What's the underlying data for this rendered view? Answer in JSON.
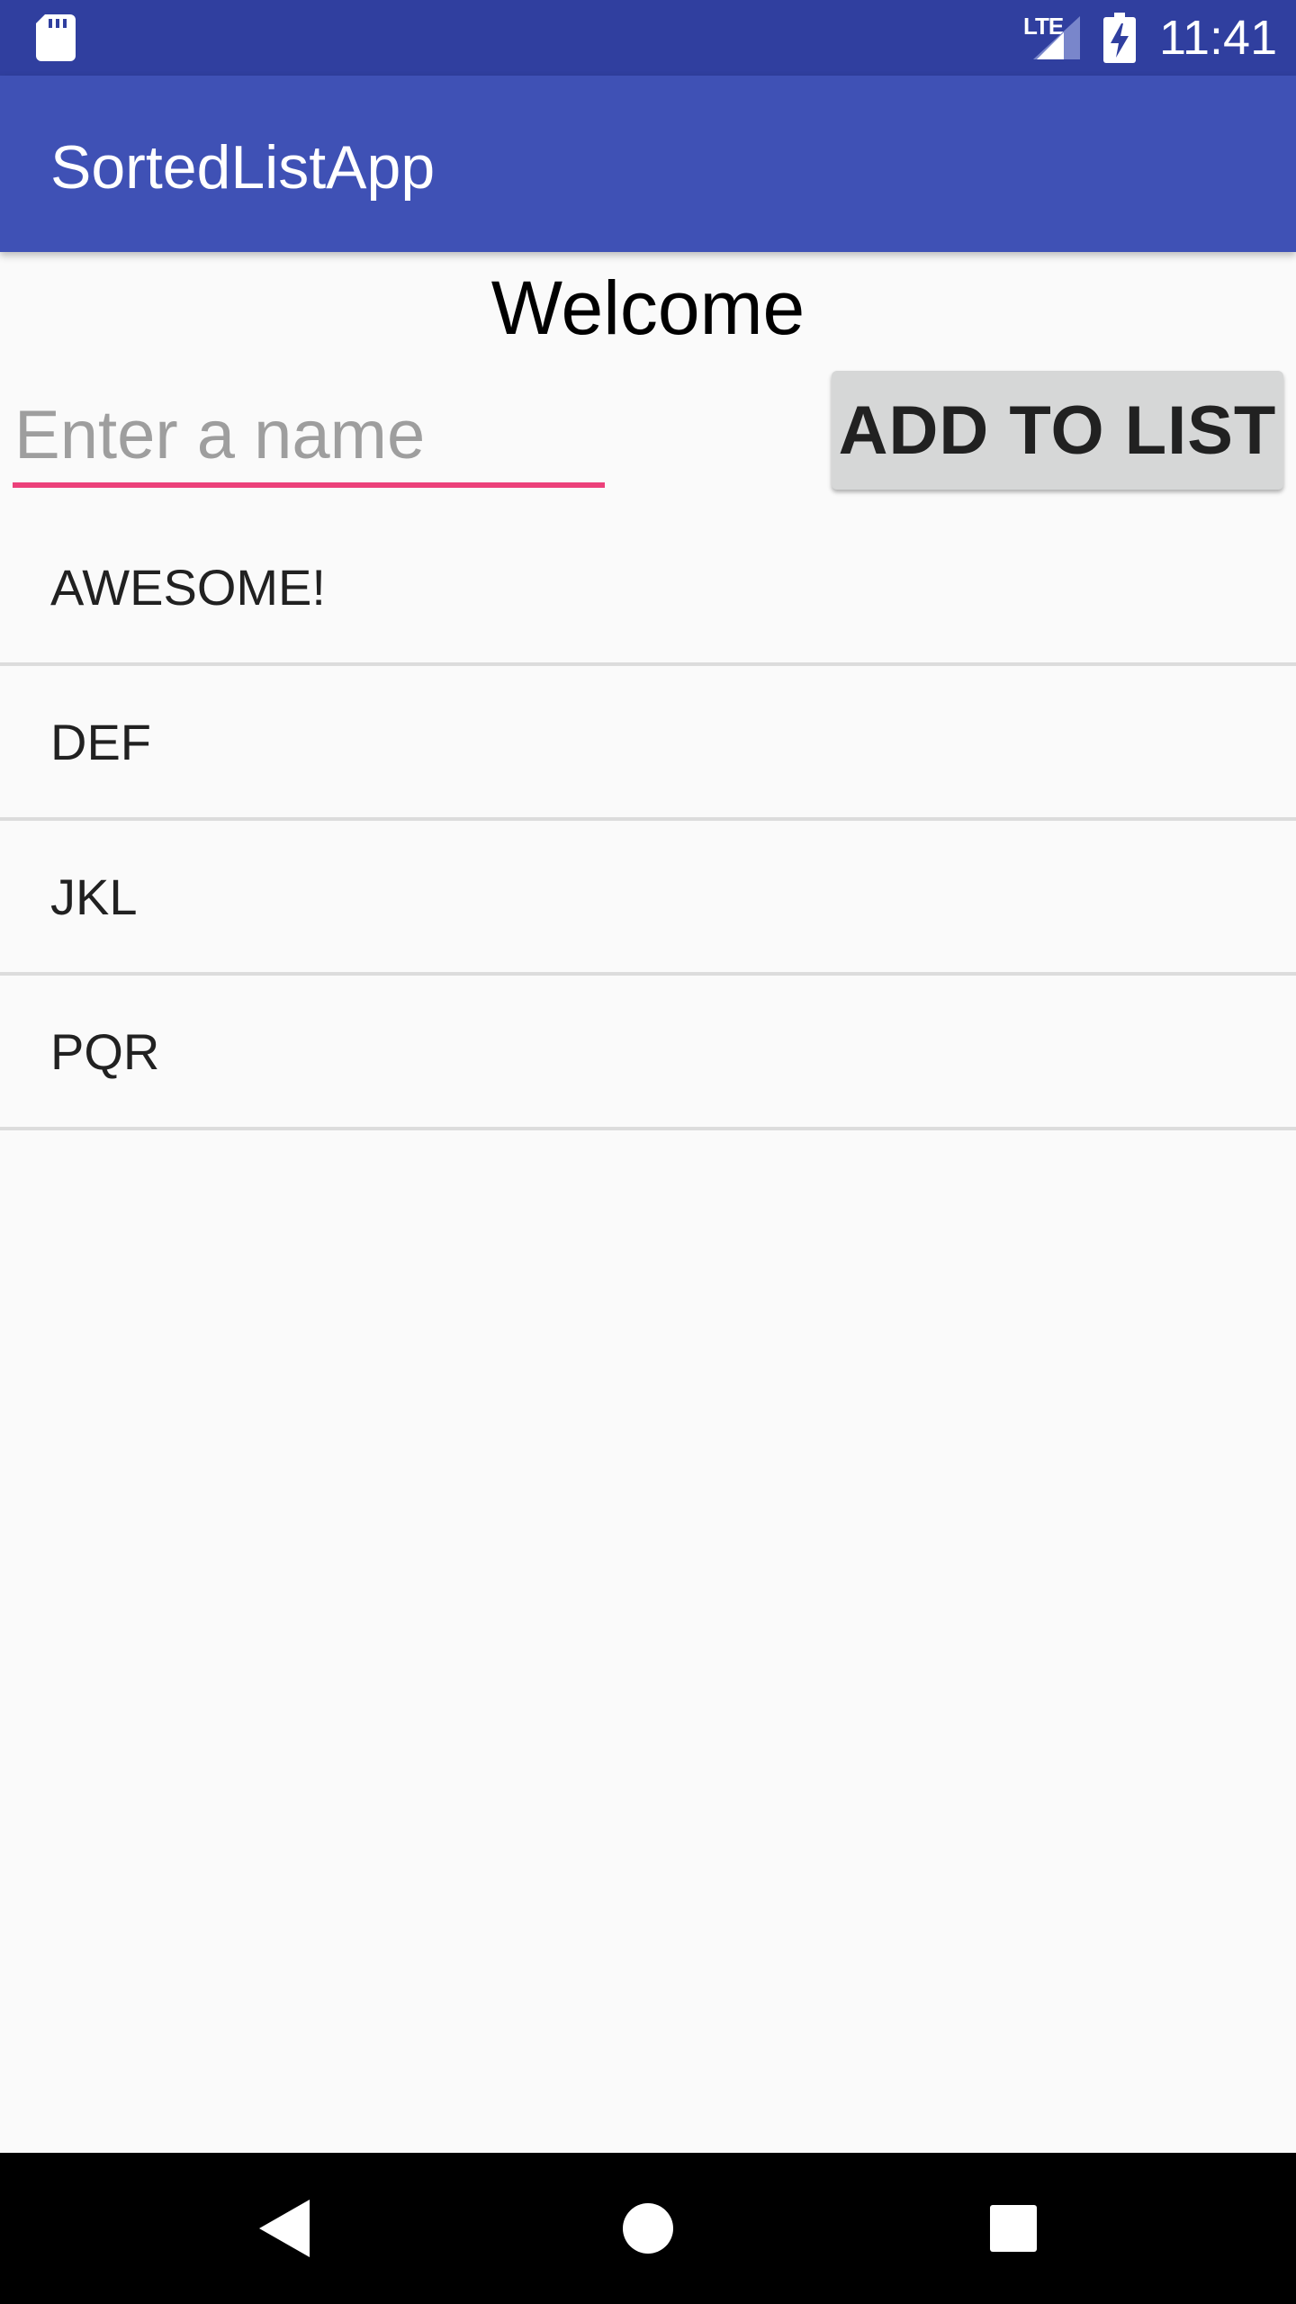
{
  "status_bar": {
    "sd_card_icon": "sd-card-icon",
    "network_label": "LTE",
    "signal_icon": "signal-icon",
    "battery_icon": "battery-charging-icon",
    "time": "11:41"
  },
  "app_bar": {
    "title": "SortedListApp",
    "color": "#3f51b5"
  },
  "main": {
    "welcome": "Welcome",
    "name_input": {
      "placeholder": "Enter a name",
      "value": "",
      "accent_color": "#ec407a"
    },
    "add_button_label": "ADD TO LIST",
    "list_items": [
      {
        "label": "AWESOME!"
      },
      {
        "label": "DEF"
      },
      {
        "label": "JKL"
      },
      {
        "label": "PQR"
      }
    ]
  },
  "nav_bar": {
    "back_icon": "back-triangle-icon",
    "home_icon": "home-circle-icon",
    "recents_icon": "recents-square-icon"
  },
  "colors": {
    "status_bar": "#303f9f",
    "app_bar": "#3f51b5",
    "accent": "#ec407a",
    "background": "#fafafa",
    "button": "#d6d7d7"
  }
}
